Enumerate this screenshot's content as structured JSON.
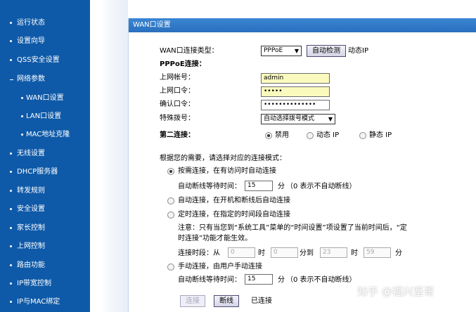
{
  "sidebar": {
    "items": [
      {
        "label": "运行状态"
      },
      {
        "label": "设置向导"
      },
      {
        "label": "QSS安全设置"
      },
      {
        "label": "网络参数"
      },
      {
        "label": "WAN口设置"
      },
      {
        "label": "LAN口设置"
      },
      {
        "label": "MAC地址克隆"
      },
      {
        "label": "无线设置"
      },
      {
        "label": "DHCP服务器"
      },
      {
        "label": "转发规则"
      },
      {
        "label": "安全设置"
      },
      {
        "label": "家长控制"
      },
      {
        "label": "上网控制"
      },
      {
        "label": "路由功能"
      },
      {
        "label": "IP带宽控制"
      },
      {
        "label": "IP与MAC绑定"
      }
    ]
  },
  "panel": {
    "title": "WAN口设置",
    "wan_type_label": "WAN口连接类型：",
    "wan_type_value": "PPPoE",
    "auto_detect_label": "自动检测",
    "dynamic_ip_label": "动态IP",
    "pppoe_heading": "PPPoE连接：",
    "account_label": "上网帐号：",
    "account_value": "admin",
    "password_label": "上网口令：",
    "password_value": "•••••",
    "confirm_label": "确认口令：",
    "confirm_value": "••••••••••••••",
    "special_dial_label": "特殊拨号：",
    "special_dial_value": "自动选择拨号模式",
    "second_conn_label": "第二连接：",
    "second_disable": "禁用",
    "second_dynamic": "动态 IP",
    "second_static": "静态 IP",
    "mode_intro": "根据您的需要，请选择对应的连接模式：",
    "on_demand_label": "按需连接，在有访问时自动连接",
    "idle_wait_label": "自动断线等待时间：",
    "idle_wait_value": "15",
    "minutes_unit": "分",
    "idle_hint": "（0 表示不自动断线）",
    "auto_conn_label": "自动连接，在开机和断线后自动连接",
    "timed_conn_label": "定时连接，在指定的时间段自动连接",
    "note_line1": "注意：只有当您到“系统工具”菜单的“时间设置”项设置了当前时间后，“定",
    "note_line2": "时连接”功能才能生效。",
    "period_label": "连接时段：从",
    "period_from_hour": "0",
    "hour_unit": "时",
    "period_from_min": "0",
    "min_to_label": "分到",
    "period_to_hour": "23",
    "period_to_min": "59",
    "manual_conn_label": "手动连接，由用户手动连接",
    "manual_wait_label": "自动断线等待时间：",
    "manual_wait_value": "15",
    "manual_hint": "（0 表示不自动断线）",
    "connect_btn": "连接",
    "disconnect_btn": "断线",
    "status_text": "已连接"
  },
  "watermark": "知乎 @福兴坚哥",
  "colors": {
    "sidebar_bg": "#0f5aa8",
    "titlebar": "#3a86d3",
    "input_highlight": "#fafabe"
  }
}
